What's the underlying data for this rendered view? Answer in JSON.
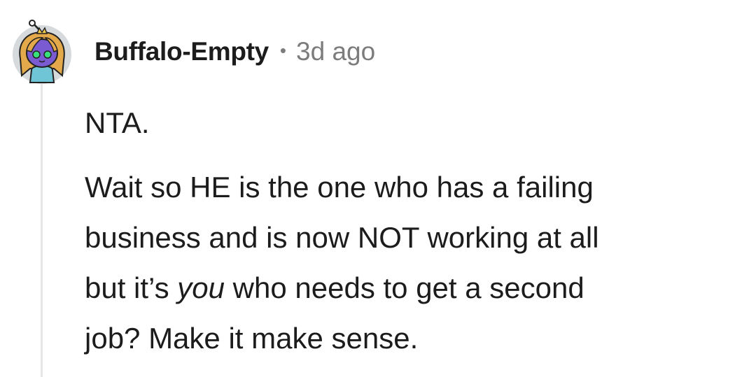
{
  "comment": {
    "author": "Buffalo-Empty",
    "separator": "•",
    "timestamp": "3d ago",
    "paragraphs": [
      "NTA.",
      {
        "line_1": "Wait so HE is the one who has a failing",
        "line_2": "business and is now NOT working at all",
        "line_3_start": "but it’s ",
        "line_3_emphasis": "you",
        "line_3_end": " who needs to get a second",
        "line_4": "job? Make it make sense."
      }
    ]
  },
  "colors": {
    "text": "#1c1c1c",
    "meta": "#7c7c7c",
    "thread_line": "#e6e6e6",
    "avatar_bg": "#d7dadc",
    "avatar_face": "#7a5bd1",
    "avatar_hair": "#e3a94a",
    "avatar_eyes": "#37e07a"
  },
  "avatar": {
    "icon": "snoo-avatar-icon"
  }
}
